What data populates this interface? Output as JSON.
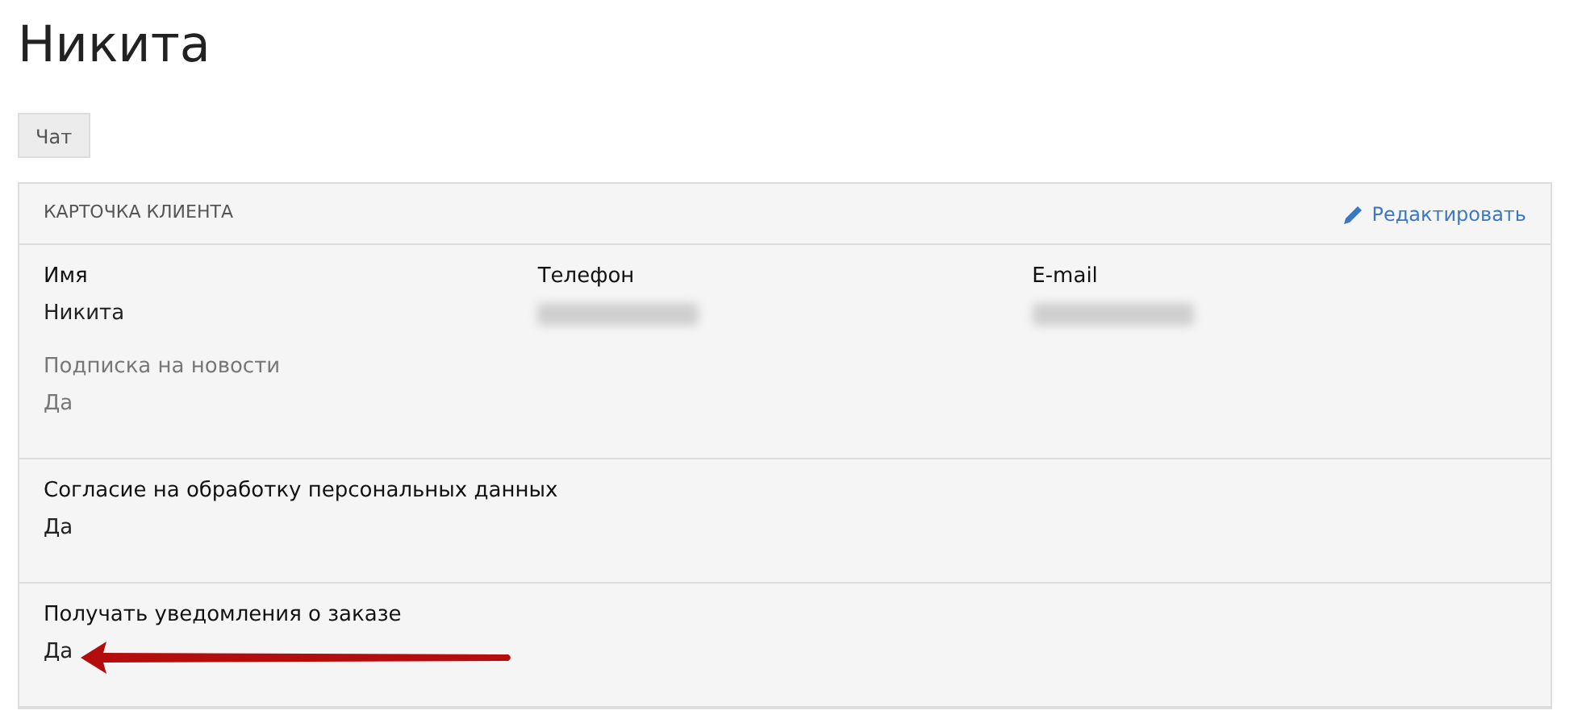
{
  "title": "Никита",
  "tabs": [
    {
      "label": "Чат",
      "selected": false
    }
  ],
  "card": {
    "title": "КАРТОЧКА КЛИЕНТА",
    "edit_link": "Редактировать",
    "sections": [
      {
        "arrow_marked": false,
        "fields": [
          {
            "kind": "text",
            "label": "Имя",
            "value": "Никита",
            "muted": false
          },
          {
            "kind": "redacted",
            "label": "Телефон",
            "muted": false
          },
          {
            "kind": "redacted",
            "label": "E-mail",
            "muted": false
          },
          {
            "kind": "text",
            "label": "Подписка на новости",
            "value": "Да",
            "muted": true
          }
        ]
      },
      {
        "arrow_marked": false,
        "fields": [
          {
            "kind": "text",
            "label": "Согласие на обработку персональных данных",
            "value": "Да",
            "muted": false
          }
        ]
      },
      {
        "arrow_marked": true,
        "fields": [
          {
            "kind": "text",
            "label": "Получать уведомления о заказе",
            "value": "Да",
            "muted": false
          }
        ]
      }
    ]
  }
}
